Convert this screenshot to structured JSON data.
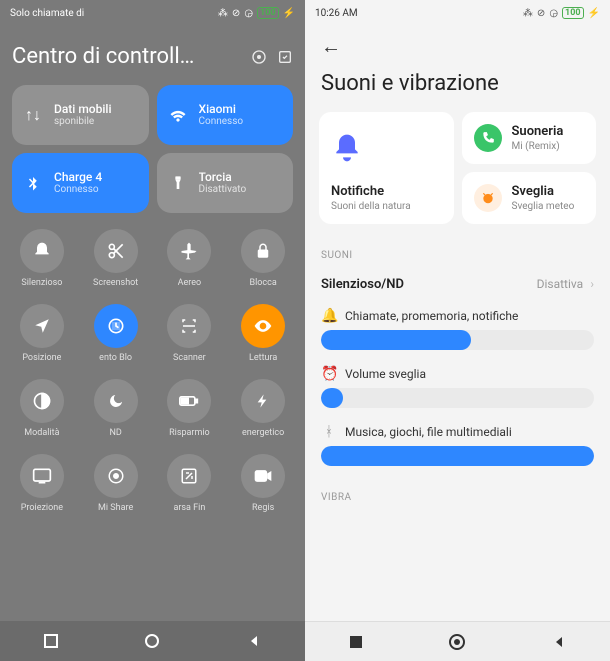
{
  "left": {
    "status_text": "Solo chiamate di",
    "battery": "100",
    "header_title": "Centro di controll…",
    "tiles": [
      {
        "label": "Dati mobili",
        "sub": "sponibile",
        "active": false,
        "icon": "data"
      },
      {
        "label": "Xiaomi",
        "sub": "Connesso",
        "active": true,
        "icon": "wifi"
      },
      {
        "label": "Charge 4",
        "sub": "Connesso",
        "active": true,
        "icon": "bluetooth"
      },
      {
        "label": "Torcia",
        "sub": "Disattivato",
        "active": false,
        "icon": "flashlight"
      }
    ],
    "toggles": [
      {
        "label": "Silenzioso",
        "state": "off",
        "icon": "bell"
      },
      {
        "label": "Screenshot",
        "state": "off",
        "icon": "scissors"
      },
      {
        "label": "Aereo",
        "state": "off",
        "icon": "airplane"
      },
      {
        "label": "Blocca",
        "state": "off",
        "icon": "lock"
      },
      {
        "label": "Posizione",
        "state": "off",
        "icon": "location"
      },
      {
        "label": "ento     Blo",
        "state": "on-blue",
        "icon": "rotation"
      },
      {
        "label": "Scanner",
        "state": "off",
        "icon": "scan"
      },
      {
        "label": "Lettura",
        "state": "on-orange",
        "icon": "eye"
      },
      {
        "label": "Modalità",
        "state": "off",
        "icon": "contrast"
      },
      {
        "label": "ND",
        "state": "off",
        "icon": "moon"
      },
      {
        "label": "Risparmio",
        "state": "off",
        "icon": "battery"
      },
      {
        "label": "energetico",
        "state": "off",
        "icon": "bolt"
      },
      {
        "label": "Proiezione",
        "state": "off",
        "icon": "screen"
      },
      {
        "label": "Mi Share",
        "state": "off",
        "icon": "share"
      },
      {
        "label": "arsa     Fin",
        "state": "off",
        "icon": "resize"
      },
      {
        "label": "Regis",
        "state": "off",
        "icon": "camera"
      }
    ]
  },
  "right": {
    "time": "10:26 AM",
    "battery": "100",
    "title": "Suoni e vibrazione",
    "cards": {
      "notifiche": {
        "title": "Notifiche",
        "sub": "Suoni della natura"
      },
      "suoneria": {
        "title": "Suoneria",
        "sub": "Mi (Remix)"
      },
      "sveglia": {
        "title": "Sveglia",
        "sub": "Sveglia meteo"
      }
    },
    "section_suoni": "SUONI",
    "row_silenzioso": {
      "label": "Silenzioso/ND",
      "value": "Disattiva"
    },
    "sliders": [
      {
        "label": "Chiamate, promemoria, notifiche",
        "fill": "fill-55",
        "icon": "bell"
      },
      {
        "label": "Volume sveglia",
        "fill": "fill-8",
        "icon": "alarm"
      },
      {
        "label": "Musica, giochi, file multimediali",
        "fill": "fill-100",
        "icon": "bluetooth"
      }
    ],
    "section_vibra": "VIBRA"
  }
}
